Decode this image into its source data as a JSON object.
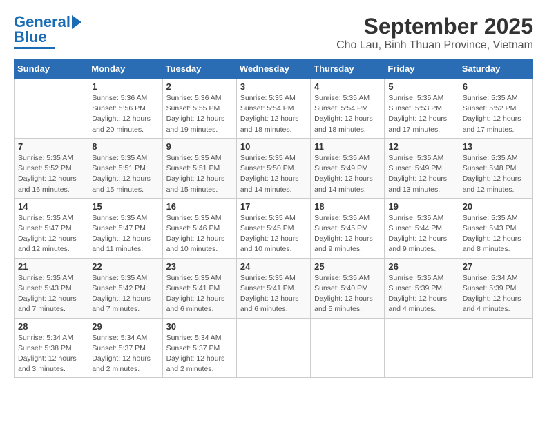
{
  "logo": {
    "line1": "General",
    "line2": "Blue"
  },
  "title": "September 2025",
  "subtitle": "Cho Lau, Binh Thuan Province, Vietnam",
  "weekdays": [
    "Sunday",
    "Monday",
    "Tuesday",
    "Wednesday",
    "Thursday",
    "Friday",
    "Saturday"
  ],
  "weeks": [
    [
      {
        "num": "",
        "info": ""
      },
      {
        "num": "1",
        "info": "Sunrise: 5:36 AM\nSunset: 5:56 PM\nDaylight: 12 hours\nand 20 minutes."
      },
      {
        "num": "2",
        "info": "Sunrise: 5:36 AM\nSunset: 5:55 PM\nDaylight: 12 hours\nand 19 minutes."
      },
      {
        "num": "3",
        "info": "Sunrise: 5:35 AM\nSunset: 5:54 PM\nDaylight: 12 hours\nand 18 minutes."
      },
      {
        "num": "4",
        "info": "Sunrise: 5:35 AM\nSunset: 5:54 PM\nDaylight: 12 hours\nand 18 minutes."
      },
      {
        "num": "5",
        "info": "Sunrise: 5:35 AM\nSunset: 5:53 PM\nDaylight: 12 hours\nand 17 minutes."
      },
      {
        "num": "6",
        "info": "Sunrise: 5:35 AM\nSunset: 5:52 PM\nDaylight: 12 hours\nand 17 minutes."
      }
    ],
    [
      {
        "num": "7",
        "info": "Sunrise: 5:35 AM\nSunset: 5:52 PM\nDaylight: 12 hours\nand 16 minutes."
      },
      {
        "num": "8",
        "info": "Sunrise: 5:35 AM\nSunset: 5:51 PM\nDaylight: 12 hours\nand 15 minutes."
      },
      {
        "num": "9",
        "info": "Sunrise: 5:35 AM\nSunset: 5:51 PM\nDaylight: 12 hours\nand 15 minutes."
      },
      {
        "num": "10",
        "info": "Sunrise: 5:35 AM\nSunset: 5:50 PM\nDaylight: 12 hours\nand 14 minutes."
      },
      {
        "num": "11",
        "info": "Sunrise: 5:35 AM\nSunset: 5:49 PM\nDaylight: 12 hours\nand 14 minutes."
      },
      {
        "num": "12",
        "info": "Sunrise: 5:35 AM\nSunset: 5:49 PM\nDaylight: 12 hours\nand 13 minutes."
      },
      {
        "num": "13",
        "info": "Sunrise: 5:35 AM\nSunset: 5:48 PM\nDaylight: 12 hours\nand 12 minutes."
      }
    ],
    [
      {
        "num": "14",
        "info": "Sunrise: 5:35 AM\nSunset: 5:47 PM\nDaylight: 12 hours\nand 12 minutes."
      },
      {
        "num": "15",
        "info": "Sunrise: 5:35 AM\nSunset: 5:47 PM\nDaylight: 12 hours\nand 11 minutes."
      },
      {
        "num": "16",
        "info": "Sunrise: 5:35 AM\nSunset: 5:46 PM\nDaylight: 12 hours\nand 10 minutes."
      },
      {
        "num": "17",
        "info": "Sunrise: 5:35 AM\nSunset: 5:45 PM\nDaylight: 12 hours\nand 10 minutes."
      },
      {
        "num": "18",
        "info": "Sunrise: 5:35 AM\nSunset: 5:45 PM\nDaylight: 12 hours\nand 9 minutes."
      },
      {
        "num": "19",
        "info": "Sunrise: 5:35 AM\nSunset: 5:44 PM\nDaylight: 12 hours\nand 9 minutes."
      },
      {
        "num": "20",
        "info": "Sunrise: 5:35 AM\nSunset: 5:43 PM\nDaylight: 12 hours\nand 8 minutes."
      }
    ],
    [
      {
        "num": "21",
        "info": "Sunrise: 5:35 AM\nSunset: 5:43 PM\nDaylight: 12 hours\nand 7 minutes."
      },
      {
        "num": "22",
        "info": "Sunrise: 5:35 AM\nSunset: 5:42 PM\nDaylight: 12 hours\nand 7 minutes."
      },
      {
        "num": "23",
        "info": "Sunrise: 5:35 AM\nSunset: 5:41 PM\nDaylight: 12 hours\nand 6 minutes."
      },
      {
        "num": "24",
        "info": "Sunrise: 5:35 AM\nSunset: 5:41 PM\nDaylight: 12 hours\nand 6 minutes."
      },
      {
        "num": "25",
        "info": "Sunrise: 5:35 AM\nSunset: 5:40 PM\nDaylight: 12 hours\nand 5 minutes."
      },
      {
        "num": "26",
        "info": "Sunrise: 5:35 AM\nSunset: 5:39 PM\nDaylight: 12 hours\nand 4 minutes."
      },
      {
        "num": "27",
        "info": "Sunrise: 5:34 AM\nSunset: 5:39 PM\nDaylight: 12 hours\nand 4 minutes."
      }
    ],
    [
      {
        "num": "28",
        "info": "Sunrise: 5:34 AM\nSunset: 5:38 PM\nDaylight: 12 hours\nand 3 minutes."
      },
      {
        "num": "29",
        "info": "Sunrise: 5:34 AM\nSunset: 5:37 PM\nDaylight: 12 hours\nand 2 minutes."
      },
      {
        "num": "30",
        "info": "Sunrise: 5:34 AM\nSunset: 5:37 PM\nDaylight: 12 hours\nand 2 minutes."
      },
      {
        "num": "",
        "info": ""
      },
      {
        "num": "",
        "info": ""
      },
      {
        "num": "",
        "info": ""
      },
      {
        "num": "",
        "info": ""
      }
    ]
  ]
}
